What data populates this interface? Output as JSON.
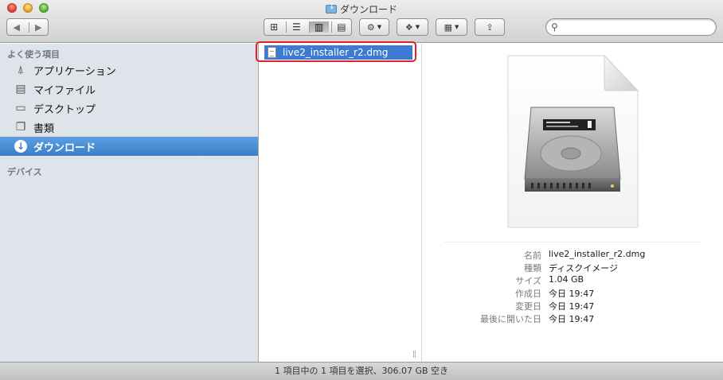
{
  "window": {
    "title": "ダウンロード"
  },
  "toolbar": {
    "back_icon": "◀",
    "forward_icon": "▶",
    "view_icons": [
      "⊞",
      "☰",
      "▥",
      "▤"
    ],
    "action_icon": "⚙",
    "dropbox_icon": "❖",
    "arrange_icon": "▦",
    "share_icon": "⇪"
  },
  "search": {
    "value": "",
    "placeholder": ""
  },
  "sidebar": {
    "favorites_header": "よく使う項目",
    "items": [
      {
        "label": "アプリケーション",
        "icon": "applications-icon"
      },
      {
        "label": "マイファイル",
        "icon": "all-my-files-icon"
      },
      {
        "label": "デスクトップ",
        "icon": "desktop-icon"
      },
      {
        "label": "書類",
        "icon": "documents-icon"
      },
      {
        "label": "ダウンロード",
        "icon": "downloads-icon",
        "selected": true
      }
    ],
    "devices_header": "デバイス"
  },
  "column": {
    "selected_file": "live2_installer_r2.dmg"
  },
  "preview": {
    "rows": [
      {
        "key": "名前",
        "value": "live2_installer_r2.dmg"
      },
      {
        "key": "種類",
        "value": "ディスクイメージ"
      },
      {
        "key": "サイズ",
        "value": "1.04 GB"
      },
      {
        "key": "作成日",
        "value": "今日 19:47"
      },
      {
        "key": "変更日",
        "value": "今日 19:47"
      },
      {
        "key": "最後に開いた日",
        "value": "今日 19:47"
      }
    ]
  },
  "statusbar": {
    "text": "1 項目中の 1 項目を選択、306.07 GB 空き"
  },
  "colors": {
    "selection": "#3d7bd3",
    "sidebar_bg": "#dfe4ea",
    "highlight": "#e0202a"
  }
}
